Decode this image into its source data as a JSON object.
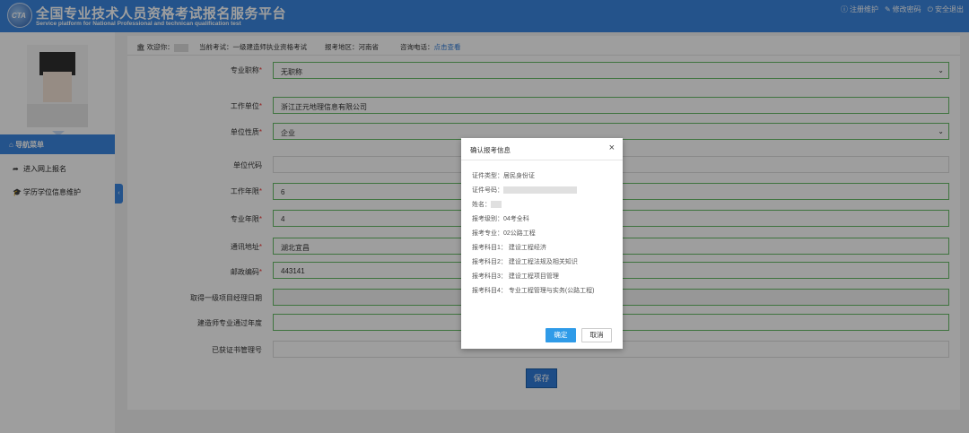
{
  "header": {
    "title": "全国专业技术人员资格考试报名服务平台",
    "subtitle": "Service platform for National Professional and technican qualification test",
    "links": [
      "注册维护",
      "修改密码",
      "安全退出"
    ]
  },
  "sidebar": {
    "nav_head": "导航菜单",
    "items": [
      {
        "label": "进入网上报名",
        "icon": "share-arrow-icon"
      },
      {
        "label": "学历学位信息维护",
        "icon": "graduation-cap-icon"
      }
    ]
  },
  "infobar": {
    "welcome": "欢迎你：",
    "exam": "当前考试：一级建造师执业资格考试",
    "region": "报考地区：河南省",
    "phone": "咨询电话：",
    "phone_link": "点击查看"
  },
  "form": {
    "rows": [
      {
        "label": "专业职称",
        "required": true,
        "value": "无职称",
        "select": true
      },
      {
        "label": "工作单位",
        "required": true,
        "value": "浙江正元地理信息有限公司"
      },
      {
        "label": "单位性质",
        "required": true,
        "value": "企业",
        "select": true
      },
      {
        "label": "单位代码",
        "required": false,
        "value": ""
      },
      {
        "label": "工作年限",
        "required": true,
        "value": "6"
      },
      {
        "label": "专业年限",
        "required": true,
        "value": "4"
      },
      {
        "label": "通讯地址",
        "required": true,
        "value": "湖北宜昌"
      },
      {
        "label": "邮政编码",
        "required": true,
        "value": "443141"
      },
      {
        "label": "取得一级项目经理日期",
        "required": false,
        "value": ""
      },
      {
        "label": "建造师专业通过年度",
        "required": false,
        "value": ""
      },
      {
        "label": "已获证书管理号",
        "required": false,
        "value": ""
      }
    ],
    "save_label": "保存"
  },
  "modal": {
    "title": "确认报考信息",
    "close": "×",
    "lines": {
      "id_type": "证件类型：居民身份证",
      "id_number": "证件号码：",
      "name": "姓名：",
      "level": "报考级别：04考全科",
      "major": "报考专业：02公路工程",
      "subject1": "报考科目1：  建设工程经济",
      "subject2": "报考科目2：  建设工程法规及相关知识",
      "subject3": "报考科目3：  建设工程项目管理",
      "subject4": "报考科目4：  专业工程管理与实务(公路工程)"
    },
    "ok_label": "确定",
    "cancel_label": "取消"
  }
}
